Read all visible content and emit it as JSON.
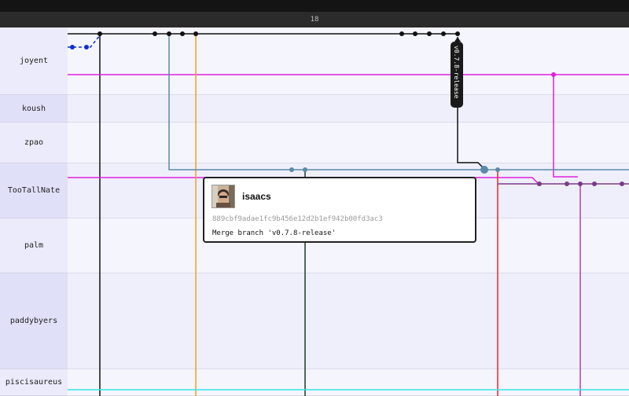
{
  "header": {
    "title": "18"
  },
  "rows": [
    {
      "label": "joyent"
    },
    {
      "label": "koush"
    },
    {
      "label": "zpao"
    },
    {
      "label": "TooTallNate"
    },
    {
      "label": "palm"
    },
    {
      "label": "paddybyers"
    },
    {
      "label": "piscisaureus"
    }
  ],
  "tag": {
    "label": "v0.7.8-release"
  },
  "popup": {
    "author": "isaacs",
    "sha": "889cbf9adae1fc9b456e12d2b1ef942b00fd3ac3",
    "message": "Merge branch 'v0.7.8-release'"
  },
  "colors": {
    "black": "#111111",
    "blue": "#1030d0",
    "magenta": "#e020e0",
    "steel": "#5a8aa8",
    "orange": "#f0a020",
    "purple": "#7a3a8a",
    "red": "#ff2020",
    "darkgreen": "#1e3a24",
    "cyan": "#30e8e8"
  }
}
